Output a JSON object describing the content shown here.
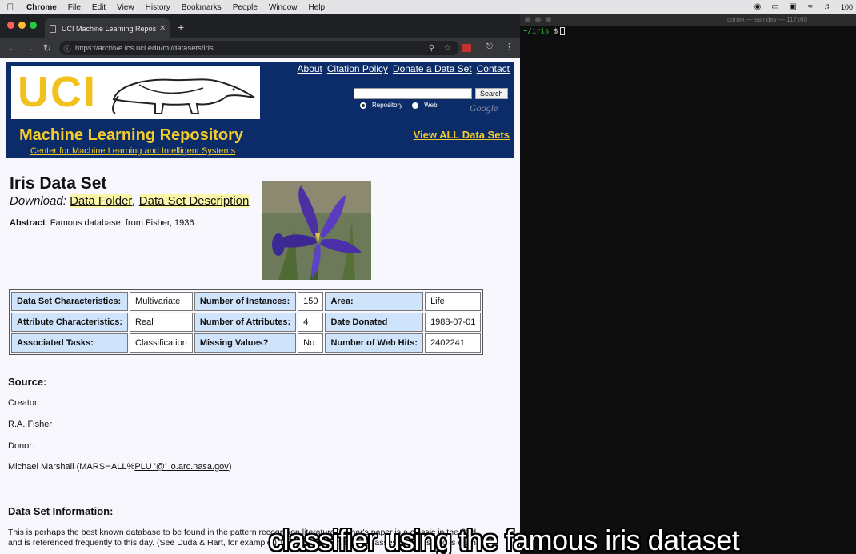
{
  "menubar": {
    "app": "Chrome",
    "items": [
      "File",
      "Edit",
      "View",
      "History",
      "Bookmarks",
      "People",
      "Window",
      "Help"
    ],
    "battery": "100"
  },
  "browser": {
    "tab_title": "UCI Machine Learning Reposito",
    "url": "https://archive.ics.uci.edu/ml/datasets/iris"
  },
  "uci_header": {
    "logo_text": "UCI",
    "title": "Machine Learning Repository",
    "subtitle": "Center for Machine Learning and Intelligent Systems",
    "links": [
      "About",
      "Citation Policy",
      "Donate a Data Set",
      "Contact"
    ],
    "search_button": "Search",
    "radio_repository": "Repository",
    "radio_web": "Web",
    "google_mark": "Google",
    "view_all": "View ALL Data Sets"
  },
  "dataset": {
    "title": "Iris Data Set",
    "download_label": "Download",
    "download_folder": "Data Folder",
    "download_description": "Data Set Description",
    "abstract_label": "Abstract",
    "abstract_text": ": Famous database; from Fisher, 1936",
    "rows": [
      [
        "Data Set Characteristics:",
        "Multivariate",
        "Number of Instances:",
        "150",
        "Area:",
        "Life"
      ],
      [
        "Attribute Characteristics:",
        "Real",
        "Number of Attributes:",
        "4",
        "Date Donated",
        "1988-07-01"
      ],
      [
        "Associated Tasks:",
        "Classification",
        "Missing Values?",
        "No",
        "Number of Web Hits:",
        "2402241"
      ]
    ]
  },
  "source": {
    "heading": "Source:",
    "creator_label": "Creator:",
    "creator": "R.A. Fisher",
    "donor_label": "Donor:",
    "donor_prefix": "Michael Marshall (MARSHALL%",
    "donor_link": "PLU '@' io.arc.nasa.gov",
    "donor_suffix": ")"
  },
  "info": {
    "heading": "Data Set Information:",
    "line1": "This is perhaps the best known database to be found in the pattern recognition literature. Fisher's paper is a classic in the field",
    "line2": "and is referenced frequently to this day. (See Duda & Hart, for example.) The data set contains 3 classes of 50 instances each,"
  },
  "terminal": {
    "title": "cortex — ssh dev — 117x60",
    "prompt_path": "~/iris",
    "prompt_symbol": "$"
  },
  "overlay": {
    "subtitle": "classifier using the famous iris dataset"
  }
}
